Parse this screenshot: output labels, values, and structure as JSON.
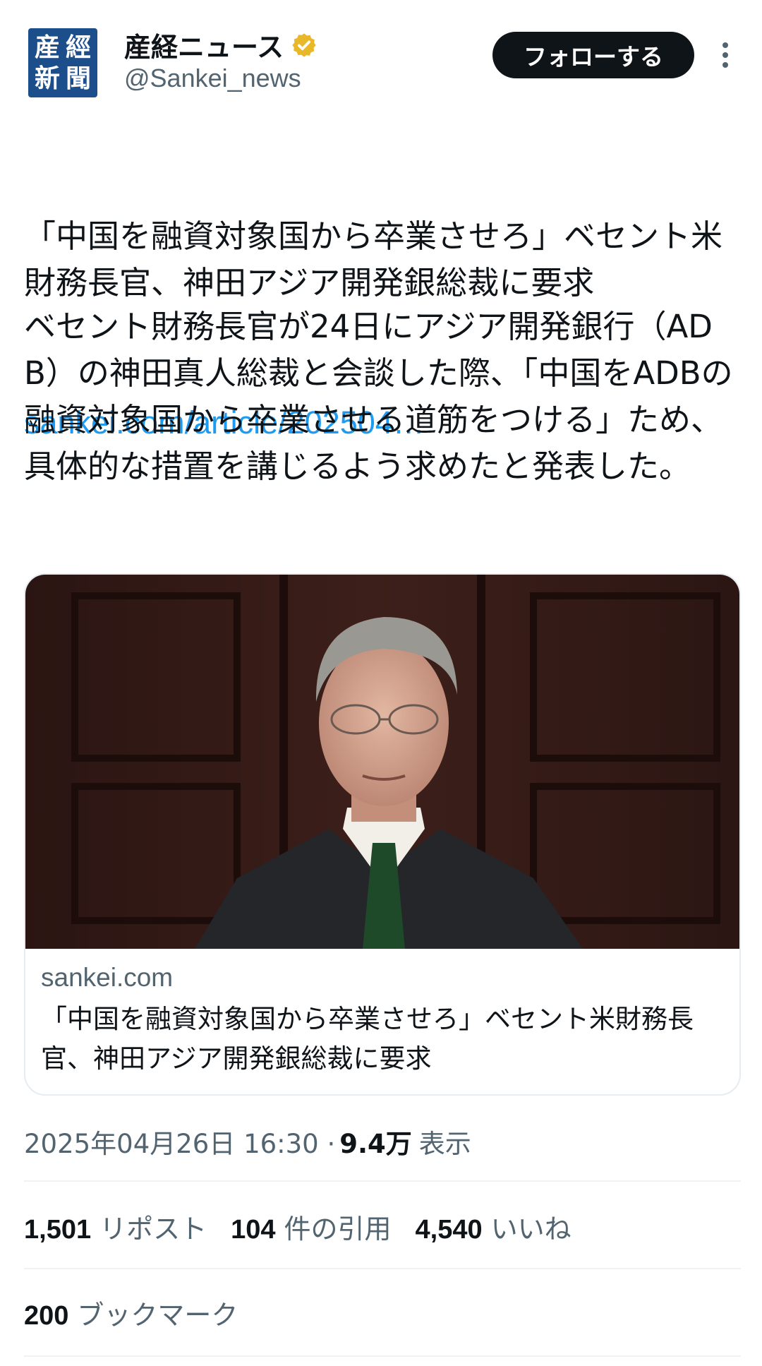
{
  "account": {
    "avatar_glyphs": [
      "産",
      "經",
      "新",
      "聞"
    ],
    "display_name": "産経ニュース",
    "handle": "@Sankei_news",
    "verified_color": "#e8b829"
  },
  "follow_button": {
    "label": "フォローする"
  },
  "tweet": {
    "headline": "「中国を融資対象国から卒業させろ」ベセント米財務長官、神田アジア開発銀総裁に要求",
    "link_text": "sankei.com/article/202504…",
    "body": "ベセント財務長官が24日にアジア開発銀行（ADB）の神田真人総裁と会談した際、「中国をADBの融資対象国から卒業させる道筋をつける」ため、具体的な措置を講じるよう求めたと発表した。"
  },
  "card": {
    "domain": "sankei.com",
    "title": "「中国を融資対象国から卒業させろ」ベセント米財務長官、神田アジア開発銀総裁に要求"
  },
  "meta": {
    "timestamp": "2025年04月26日 16:30 ·",
    "views_count": "9.4万",
    "views_label": "表示"
  },
  "stats": {
    "reposts_count": "1,501",
    "reposts_label": "リポスト",
    "quotes_count": "104",
    "quotes_label": "件の引用",
    "likes_count": "4,540",
    "likes_label": "いいね",
    "bookmarks_count": "200",
    "bookmarks_label": "ブックマーク"
  },
  "colors": {
    "link": "#1d9bf0",
    "muted": "#536471",
    "text": "#0f1419",
    "button": "#0f1419"
  },
  "icons": {
    "verified": "verified-badge-icon",
    "more": "more-options-icon"
  }
}
